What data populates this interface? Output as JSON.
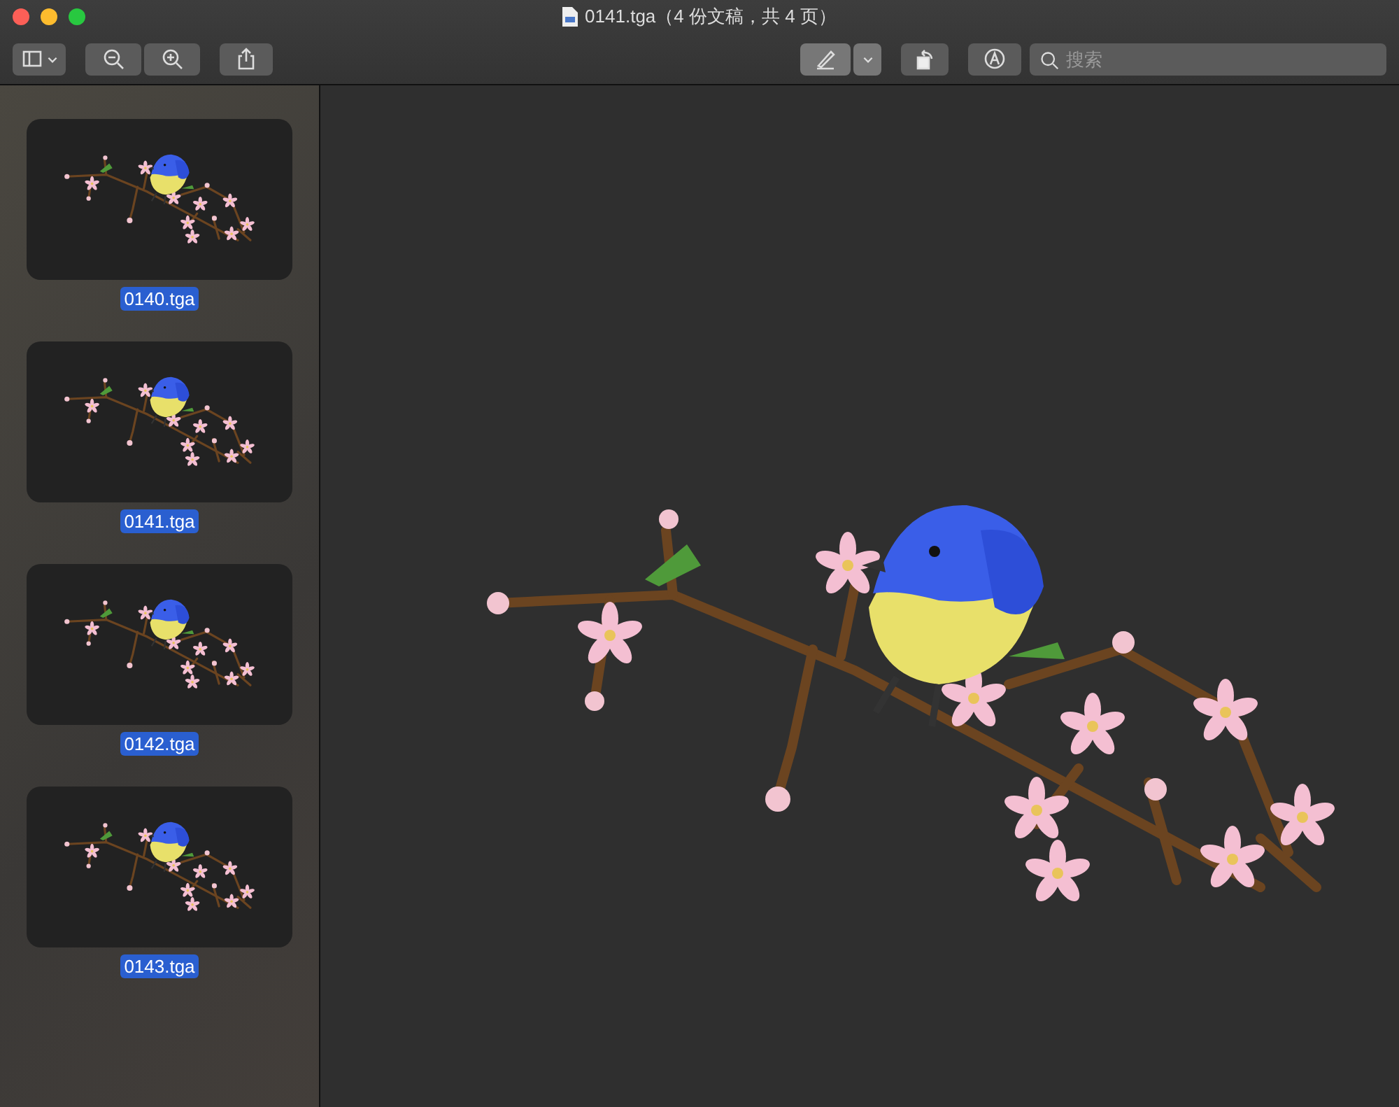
{
  "window": {
    "title": "0141.tga（4 份文稿，共 4 页）"
  },
  "toolbar": {
    "search": {
      "placeholder": "搜索"
    }
  },
  "sidebar": {
    "items": [
      {
        "label": "0140.tga",
        "selected": true
      },
      {
        "label": "0141.tga",
        "selected": true
      },
      {
        "label": "0142.tga",
        "selected": true
      },
      {
        "label": "0143.tga",
        "selected": true
      }
    ]
  }
}
